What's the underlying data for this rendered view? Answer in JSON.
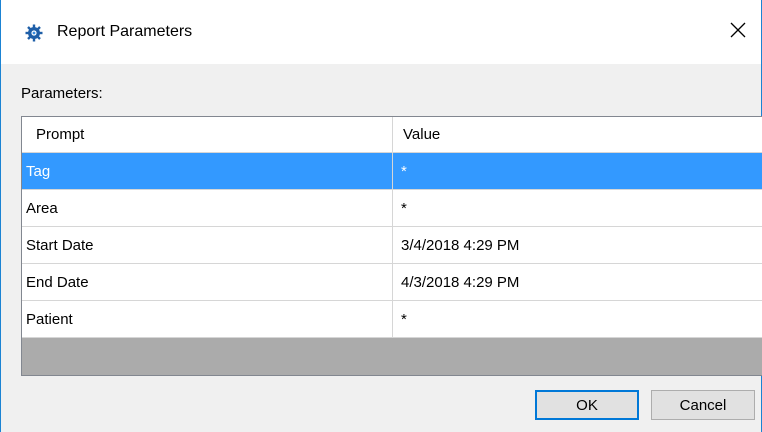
{
  "window": {
    "title": "Report Parameters",
    "icon": "gear-icon",
    "close_glyph": "✕"
  },
  "parameters_label": "Parameters:",
  "grid": {
    "columns": [
      "Prompt",
      "Value"
    ],
    "rows": [
      {
        "prompt": "Tag",
        "value": "*",
        "selected": true
      },
      {
        "prompt": "Area",
        "value": "*",
        "selected": false
      },
      {
        "prompt": "Start Date",
        "value": "3/4/2018 4:29 PM",
        "selected": false
      },
      {
        "prompt": "End Date",
        "value": "4/3/2018 4:29 PM",
        "selected": false
      },
      {
        "prompt": "Patient",
        "value": "*",
        "selected": false
      }
    ]
  },
  "buttons": {
    "ok": "OK",
    "cancel": "Cancel"
  },
  "colors": {
    "selection": "#3399ff",
    "window_border": "#1b83d3",
    "empty_grid_area": "#ababab"
  }
}
